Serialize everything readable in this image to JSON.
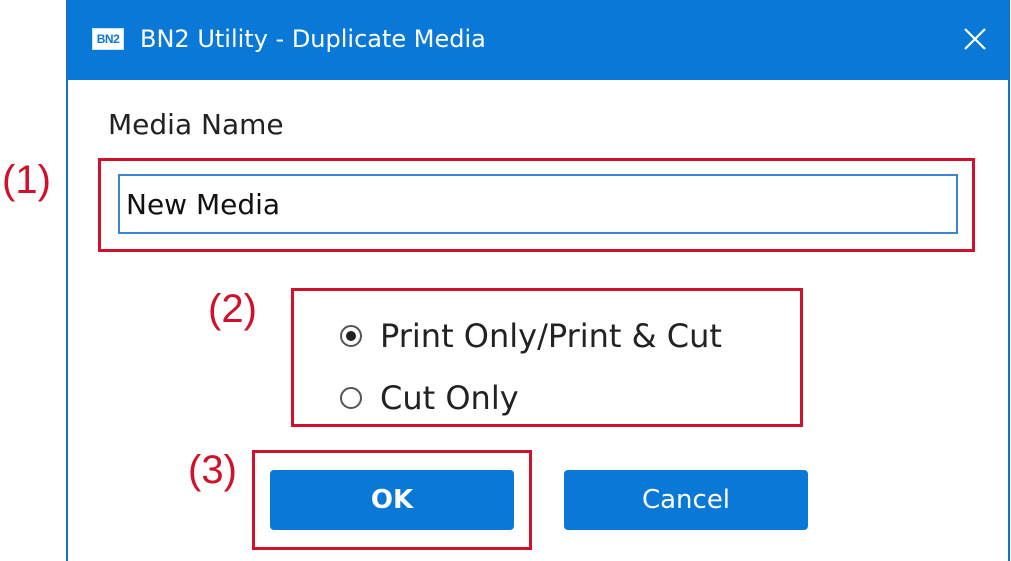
{
  "window": {
    "title": "BN2 Utility - Duplicate Media",
    "app_icon_text": "BN2",
    "titlebar_color": "#0a78d7",
    "close_icon": "close-icon"
  },
  "form": {
    "media_name_label": "Media Name",
    "media_name_value": "New Media"
  },
  "media_type": {
    "options": [
      {
        "label": "Print Only/Print & Cut",
        "selected": true
      },
      {
        "label": "Cut Only",
        "selected": false
      }
    ]
  },
  "buttons": {
    "ok_label": "OK",
    "cancel_label": "Cancel",
    "color": "#0a78d7"
  },
  "annotations": {
    "color": "#d0112b",
    "labels": [
      "(1)",
      "(2)",
      "(3)"
    ]
  }
}
